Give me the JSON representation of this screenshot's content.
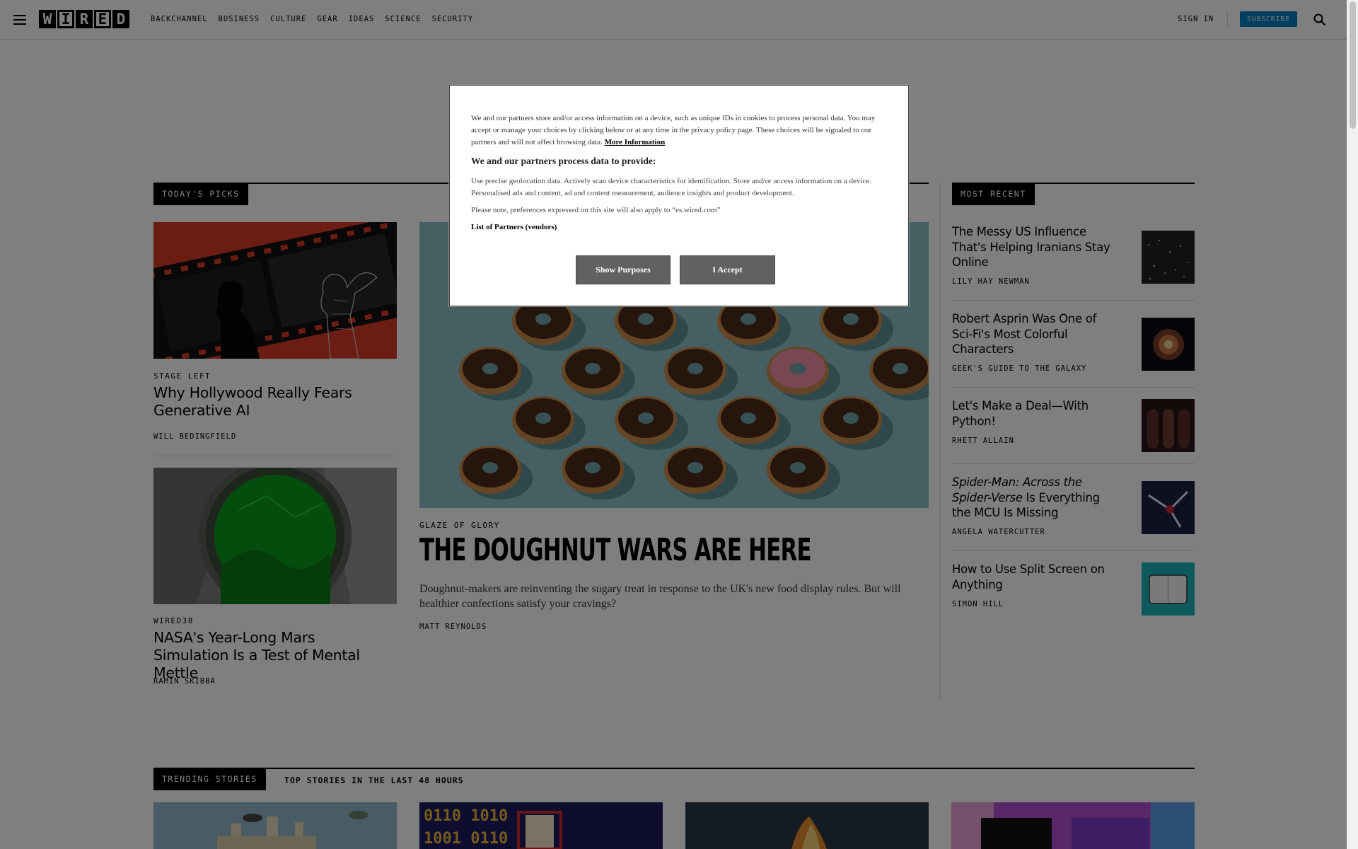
{
  "header": {
    "logo_letters": [
      "W",
      "I",
      "R",
      "E",
      "D"
    ],
    "nav": [
      "BACKCHANNEL",
      "BUSINESS",
      "CULTURE",
      "GEAR",
      "IDEAS",
      "SCIENCE",
      "SECURITY"
    ],
    "sign_in": "SIGN IN",
    "subscribe": "SUBSCRIBE"
  },
  "todays_picks": {
    "label": "TODAY'S PICKS",
    "items": [
      {
        "kicker": "STAGE LEFT",
        "headline": "Why Hollywood Really Fears Generative AI",
        "byline": "WILL BEDINGFIELD"
      },
      {
        "kicker": "WIRED38",
        "headline": "NASA's Year-Long Mars Simulation Is a Test of Mental Mettle",
        "byline": "RAMIN SKIBBA"
      }
    ]
  },
  "lead_story": {
    "kicker": "GLAZE OF GLORY",
    "headline": "THE DOUGHNUT WARS ARE HERE",
    "dek": "Doughnut-makers are reinventing the sugary treat in response to the UK's new food display rules. But will healthier confections satisfy your cravings?",
    "byline": "MATT REYNOLDS"
  },
  "most_recent": {
    "label": "MOST RECENT",
    "items": [
      {
        "headline": "The Messy US Influence That's Helping Iranians Stay Online",
        "byline": "LILY HAY NEWMAN"
      },
      {
        "headline": "Robert Asprin Was One of Sci-Fi's Most Colorful Characters",
        "byline": "GEEK'S GUIDE TO THE GALAXY"
      },
      {
        "headline": "Let's Make a Deal—With Python!",
        "byline": "RHETT ALLAIN"
      },
      {
        "headline_italic": "Spider-Man: Across the Spider-Verse",
        "headline_rest": " Is Everything the MCU Is Missing",
        "byline": "ANGELA WATERCUTTER"
      },
      {
        "headline": "How to Use Split Screen on Anything",
        "byline": "SIMON HILL"
      }
    ]
  },
  "trending": {
    "label": "TRENDING STORIES",
    "sub": "TOP STORIES IN THE LAST 48 HOURS"
  },
  "consent": {
    "intro": "We and our partners store and/or access information on a device, such as unique IDs in cookies to process personal data. You may accept or manage your choices by clicking below or at any time in the privacy policy page. These choices will be signaled to our partners and will not affect browsing data.",
    "more_info": "More Information",
    "heading": "We and our partners process data to provide:",
    "body": "Use precise geolocation data. Actively scan device characteristics for identification. Store and/or access information on a device. Personalised ads and content, ad and content measurement, audience insights and product development.",
    "note": "Please note, preferences expressed on this site will also apply to “es.wired.com”",
    "partners_link": "List of Partners (vendors)",
    "show_purposes": "Show Purposes",
    "accept": "I Accept"
  },
  "colors": {
    "subscribe_bg": "#057dbc",
    "overlay": "rgba(0,0,0,0.5)",
    "modal_button": "#616161"
  }
}
